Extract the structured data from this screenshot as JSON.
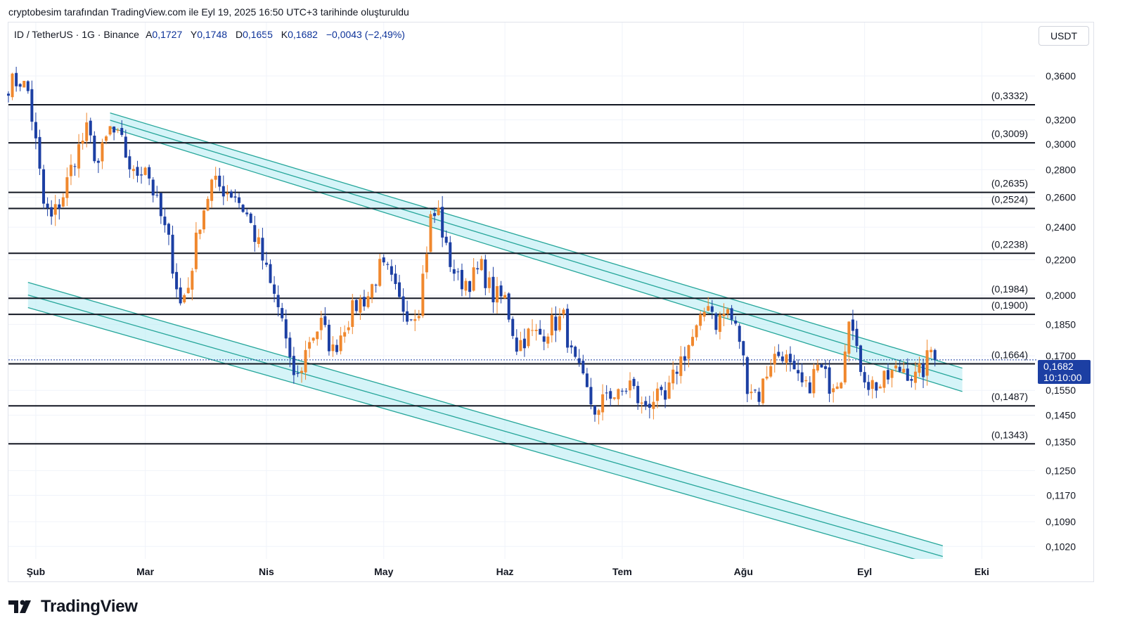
{
  "caption": "cryptobesim tarafından TradingView.com ile Eyl 19, 2025 16:50 UTC+3 tarihinde oluşturuldu",
  "legend": {
    "symbol": "ID / TetherUS · 1G · Binance",
    "open_label": "A",
    "open": "0,1727",
    "high_label": "Y",
    "high": "0,1748",
    "low_label": "D",
    "low": "0,1655",
    "close_label": "K",
    "close": "0,1682",
    "change": "−0,0043 (−2,49%)"
  },
  "currency_button": "USDT",
  "brand": "TradingView",
  "price_badge": {
    "price": "0,1682",
    "countdown": "10:10:00"
  },
  "colors": {
    "up": "#f0882e",
    "down": "#1c3fa3",
    "channel": "#26a69a",
    "channel_fill": "#b2ebf2",
    "level": "#131722",
    "badge": "#1c3fa3"
  },
  "chart_data": {
    "type": "candlestick",
    "symbol": "ID / TetherUS",
    "interval": "1G",
    "y_scale": "log",
    "ylim": [
      0.102,
      0.37
    ],
    "y_ticks": [
      "0,3600",
      "0,3200",
      "0,3000",
      "0,2800",
      "0,2600",
      "0,2400",
      "0,2200",
      "0,2000",
      "0,1850",
      "0,1700",
      "0,1550",
      "0,1450",
      "0,1350",
      "0,1250",
      "0,1170",
      "0,1090",
      "0,1020"
    ],
    "x_ticks": [
      "Şub",
      "Mar",
      "Nis",
      "May",
      "Haz",
      "Tem",
      "Ağu",
      "Eyl",
      "Eki"
    ],
    "horizontal_levels": [
      {
        "label": "(0,3332)",
        "value": 0.3332
      },
      {
        "label": "(0,3009)",
        "value": 0.3009
      },
      {
        "label": "(0,2635)",
        "value": 0.2635
      },
      {
        "label": "(0,2524)",
        "value": 0.2524
      },
      {
        "label": "(0,2238)",
        "value": 0.2238
      },
      {
        "label": "(0,1984)",
        "value": 0.1984
      },
      {
        "label": "(0,1900)",
        "value": 0.19
      },
      {
        "label": "(0,1664)",
        "value": 0.1664
      },
      {
        "label": "(0,1487)",
        "value": 0.1487
      },
      {
        "label": "(0,1343)",
        "value": 0.1343
      }
    ],
    "channels": [
      {
        "name": "upper",
        "start": {
          "date": "2025-02-20",
          "upper": 0.326,
          "lower": 0.3135
        },
        "end": {
          "date": "2025-09-26",
          "upper": 0.1645,
          "lower": 0.1545
        }
      },
      {
        "name": "lower",
        "start": {
          "date": "2025-01-30",
          "upper": 0.207,
          "lower": 0.1935
        },
        "end": {
          "date": "2025-09-21",
          "upper": 0.1022,
          "lower": 0.0965
        }
      }
    ],
    "last_close": 0.1682,
    "price_path": [
      [
        "2025-01-25",
        0.352
      ],
      [
        "2025-01-28",
        0.356
      ],
      [
        "2025-01-30",
        0.345
      ],
      [
        "2025-02-01",
        0.3
      ],
      [
        "2025-02-03",
        0.255
      ],
      [
        "2025-02-05",
        0.245
      ],
      [
        "2025-02-08",
        0.262
      ],
      [
        "2025-02-11",
        0.29
      ],
      [
        "2025-02-14",
        0.31
      ],
      [
        "2025-02-17",
        0.285
      ],
      [
        "2025-02-20",
        0.312
      ],
      [
        "2025-02-23",
        0.3
      ],
      [
        "2025-02-26",
        0.275
      ],
      [
        "2025-03-01",
        0.285
      ],
      [
        "2025-03-04",
        0.255
      ],
      [
        "2025-03-07",
        0.23
      ],
      [
        "2025-03-10",
        0.195
      ],
      [
        "2025-03-12",
        0.205
      ],
      [
        "2025-03-15",
        0.245
      ],
      [
        "2025-03-18",
        0.27
      ],
      [
        "2025-03-21",
        0.266
      ],
      [
        "2025-03-24",
        0.262
      ],
      [
        "2025-03-27",
        0.248
      ],
      [
        "2025-03-30",
        0.228
      ],
      [
        "2025-04-02",
        0.205
      ],
      [
        "2025-04-05",
        0.188
      ],
      [
        "2025-04-07",
        0.165
      ],
      [
        "2025-04-09",
        0.16
      ],
      [
        "2025-04-12",
        0.178
      ],
      [
        "2025-04-15",
        0.185
      ],
      [
        "2025-04-18",
        0.172
      ],
      [
        "2025-04-21",
        0.185
      ],
      [
        "2025-04-24",
        0.195
      ],
      [
        "2025-04-27",
        0.2
      ],
      [
        "2025-04-30",
        0.215
      ],
      [
        "2025-05-02",
        0.212
      ],
      [
        "2025-05-05",
        0.196
      ],
      [
        "2025-05-08",
        0.19
      ],
      [
        "2025-05-10",
        0.195
      ],
      [
        "2025-05-13",
        0.245
      ],
      [
        "2025-05-15",
        0.25
      ],
      [
        "2025-05-17",
        0.225
      ],
      [
        "2025-05-20",
        0.208
      ],
      [
        "2025-05-23",
        0.208
      ],
      [
        "2025-05-26",
        0.215
      ],
      [
        "2025-05-29",
        0.2
      ],
      [
        "2025-06-01",
        0.198
      ],
      [
        "2025-06-04",
        0.175
      ],
      [
        "2025-06-07",
        0.18
      ],
      [
        "2025-06-10",
        0.18
      ],
      [
        "2025-06-13",
        0.185
      ],
      [
        "2025-06-16",
        0.188
      ],
      [
        "2025-06-18",
        0.17
      ],
      [
        "2025-06-20",
        0.162
      ],
      [
        "2025-06-23",
        0.15
      ],
      [
        "2025-06-25",
        0.145
      ],
      [
        "2025-06-27",
        0.155
      ],
      [
        "2025-06-30",
        0.152
      ],
      [
        "2025-07-03",
        0.158
      ],
      [
        "2025-07-06",
        0.148
      ],
      [
        "2025-07-09",
        0.152
      ],
      [
        "2025-07-12",
        0.15
      ],
      [
        "2025-07-15",
        0.165
      ],
      [
        "2025-07-18",
        0.175
      ],
      [
        "2025-07-21",
        0.185
      ],
      [
        "2025-07-23",
        0.198
      ],
      [
        "2025-07-25",
        0.186
      ],
      [
        "2025-07-28",
        0.192
      ],
      [
        "2025-07-31",
        0.178
      ],
      [
        "2025-08-02",
        0.158
      ],
      [
        "2025-08-05",
        0.153
      ],
      [
        "2025-08-08",
        0.168
      ],
      [
        "2025-08-11",
        0.172
      ],
      [
        "2025-08-14",
        0.16
      ],
      [
        "2025-08-17",
        0.155
      ],
      [
        "2025-08-20",
        0.165
      ],
      [
        "2025-08-23",
        0.158
      ],
      [
        "2025-08-26",
        0.162
      ],
      [
        "2025-08-28",
        0.192
      ],
      [
        "2025-08-30",
        0.17
      ],
      [
        "2025-09-02",
        0.158
      ],
      [
        "2025-09-05",
        0.157
      ],
      [
        "2025-09-08",
        0.162
      ],
      [
        "2025-09-11",
        0.165
      ],
      [
        "2025-09-14",
        0.16
      ],
      [
        "2025-09-16",
        0.164
      ],
      [
        "2025-09-18",
        0.1727
      ],
      [
        "2025-09-19",
        0.1682
      ]
    ]
  }
}
